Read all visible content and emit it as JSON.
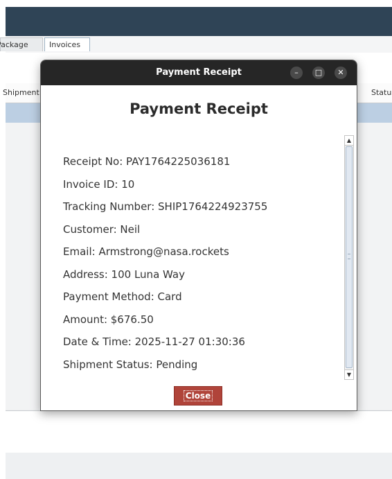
{
  "tabs": [
    "Package",
    "Invoices"
  ],
  "table_headers": {
    "shipment": "Shipment",
    "status": "Status"
  },
  "dialog": {
    "window_title": "Payment Receipt",
    "heading": "Payment Receipt",
    "lines": [
      "Receipt No: PAY1764225036181",
      "Invoice ID: 10",
      "Tracking Number: SHIP1764224923755",
      "Customer: Neil",
      "Email: Armstrong@nasa.rockets",
      "Address: 100 Luna Way",
      "Payment Method: Card",
      "Amount: $676.50",
      "Date & Time: 2025-11-27 01:30:36",
      "Shipment Status: Pending"
    ],
    "close_label": "Close"
  },
  "icons": {
    "minimize": "minimize-icon",
    "maximize": "maximize-icon",
    "close": "close-icon",
    "scroll_up": "arrow-up-icon",
    "scroll_down": "arrow-down-icon"
  },
  "colors": {
    "app_titlebar": "#2f4456",
    "dialog_titlebar": "#262626",
    "close_button": "#b0443a",
    "selected_row": "#bccfe3"
  }
}
